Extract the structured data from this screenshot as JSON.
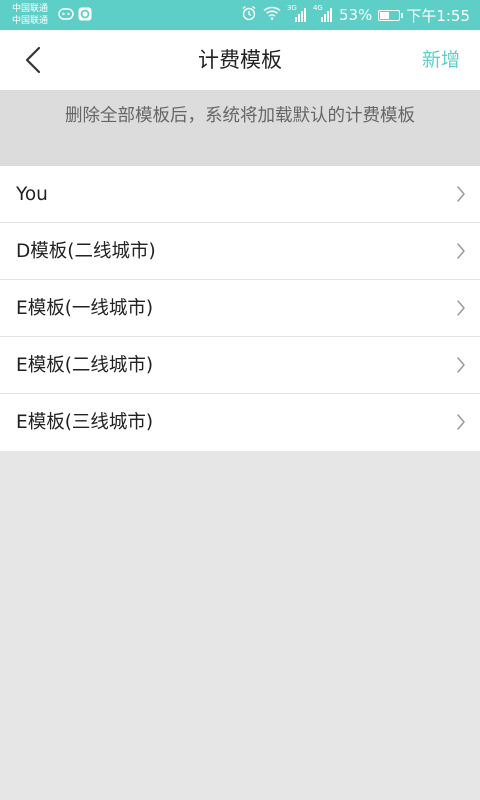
{
  "status_bar": {
    "carrier1": "中国联通",
    "carrier2": "中国联通",
    "network_3g": "3G",
    "network_4g": "4G",
    "battery": "53%",
    "battery_level": 0.53,
    "time": "下午1:55"
  },
  "nav": {
    "title": "计费模板",
    "action": "新增"
  },
  "notice": "删除全部模板后，系统将加载默认的计费模板",
  "templates": [
    {
      "label": "You"
    },
    {
      "label": "D模板(二线城市)"
    },
    {
      "label": "E模板(一线城市)"
    },
    {
      "label": "E模板(二线城市)"
    },
    {
      "label": "E模板(三线城市)"
    }
  ],
  "colors": {
    "accent": "#5ecfc7",
    "background": "#e6e6e6",
    "notice_bg": "#dcdcdc"
  }
}
